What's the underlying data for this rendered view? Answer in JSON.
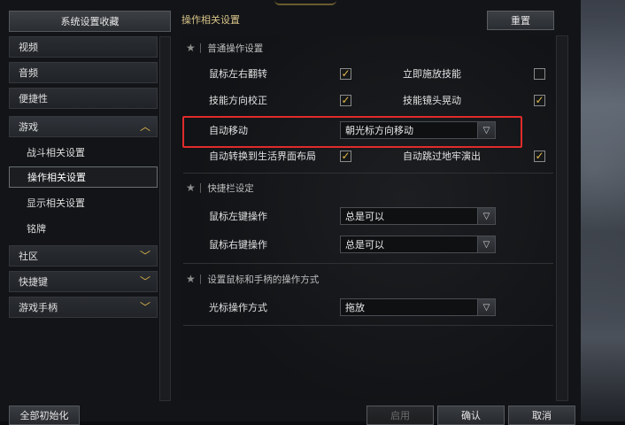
{
  "left": {
    "header": "系统设置收藏",
    "items": [
      {
        "label": "视频"
      },
      {
        "label": "音频"
      },
      {
        "label": "便捷性"
      },
      {
        "label": "游戏"
      },
      {
        "label": "战斗相关设置"
      },
      {
        "label": "操作相关设置"
      },
      {
        "label": "显示相关设置"
      },
      {
        "label": "铭牌"
      },
      {
        "label": "社区"
      },
      {
        "label": "快捷键"
      },
      {
        "label": "游戏手柄"
      }
    ],
    "reset_all": "全部初始化"
  },
  "right": {
    "title": "操作相关设置",
    "reset": "重置",
    "sections": {
      "general": "普通操作设置",
      "quickbar": "快捷栏设定",
      "mouse_pad": "设置鼠标和手柄的操作方式"
    },
    "options": {
      "mouse_flip": "鼠标左右翻转",
      "instant_skill": "立即施放技能",
      "skill_dir": "技能方向校正",
      "skill_cam_shake": "技能镜头晃动",
      "auto_move": "自动移动",
      "auto_move_value": "朝光标方向移动",
      "auto_life_layout": "自动转换到生活界面布局",
      "auto_skip_dungeon": "自动跳过地牢演出",
      "mouse_left_op": "鼠标左键操作",
      "mouse_left_value": "总是可以",
      "mouse_right_op": "鼠标右键操作",
      "mouse_right_value": "总是可以",
      "cursor_mode": "光标操作方式",
      "cursor_mode_value": "拖放"
    },
    "checks": {
      "mouse_flip": true,
      "instant_skill": false,
      "skill_dir": true,
      "skill_cam_shake": true,
      "auto_life_layout": true,
      "auto_skip_dungeon": true
    }
  },
  "footer": {
    "apply": "启用",
    "confirm": "确认",
    "cancel": "取消"
  },
  "colors": {
    "accent": "#d9b24a",
    "highlight": "#e02b2b"
  }
}
